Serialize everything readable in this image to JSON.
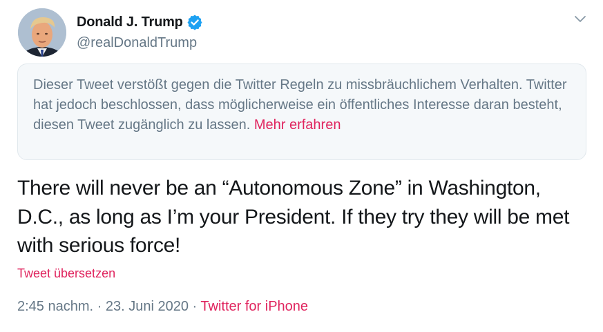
{
  "author": {
    "display_name": "Donald J. Trump",
    "handle": "@realDonaldTrump",
    "verified": true
  },
  "notice": {
    "text": "Dieser Tweet verstößt gegen die Twitter Regeln zu missbräuchlichem Verhalten. Twitter hat jedoch beschlossen, dass möglicherweise ein öffentliches Interesse daran besteht, diesen Tweet zugänglich zu lassen.",
    "link_label": "Mehr erfahren"
  },
  "tweet": {
    "text": "There will never be an “Autonomous Zone” in Washington, D.C., as long as I’m your President. If they try they will be met with serious force!",
    "translate_label": "Tweet übersetzen"
  },
  "meta": {
    "time": "2:45 nachm.",
    "separator": "·",
    "date": "23. Juni 2020",
    "source": "Twitter for iPhone"
  },
  "icons": {
    "verified": "verified-badge-icon",
    "menu": "chevron-down-icon"
  },
  "colors": {
    "accent": "#e0245e",
    "verified": "#1da1f2",
    "secondary_text": "#657786",
    "notice_bg": "#f5f8fa"
  }
}
